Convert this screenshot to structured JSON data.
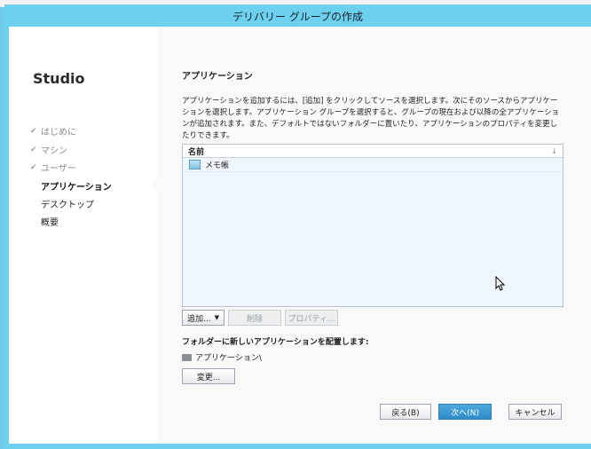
{
  "window": {
    "title": "デリバリー グループの作成"
  },
  "sidebar": {
    "brand": "Studio",
    "steps": [
      {
        "label": "はじめに",
        "state": "done"
      },
      {
        "label": "マシン",
        "state": "done"
      },
      {
        "label": "ユーザー",
        "state": "done"
      },
      {
        "label": "アプリケーション",
        "state": "active"
      },
      {
        "label": "デスクトップ",
        "state": "pending"
      },
      {
        "label": "概要",
        "state": "pending"
      }
    ],
    "check_glyph": "✔"
  },
  "main": {
    "heading": "アプリケーション",
    "description": "アプリケーションを追加するには、[追加] をクリックしてソースを選択します。次にそのソースからアプリケーションを選択します。アプリケーション グループを選択すると、グループの現在および以降の全アプリケーションが追加されます。また、デフォルトではないフォルダーに置いたり、アプリケーションのプロパティを変更したりできます。",
    "list": {
      "column_header": "名前",
      "sort_icon": "↓",
      "rows": [
        {
          "name": "メモ帳",
          "icon": "app-icon"
        }
      ]
    },
    "buttons": {
      "add": "追加...",
      "delete": "削除",
      "properties": "プロパティ..."
    },
    "folder": {
      "label": "フォルダーに新しいアプリケーションを配置します:",
      "path": "アプリケーション\\",
      "change_button": "変更..."
    }
  },
  "footer": {
    "back": "戻る(B)",
    "next": "次へ(N)",
    "cancel": "キャンセル"
  },
  "colors": {
    "titlebar": "#6dd0ec",
    "primary": "#2c8cc7"
  }
}
